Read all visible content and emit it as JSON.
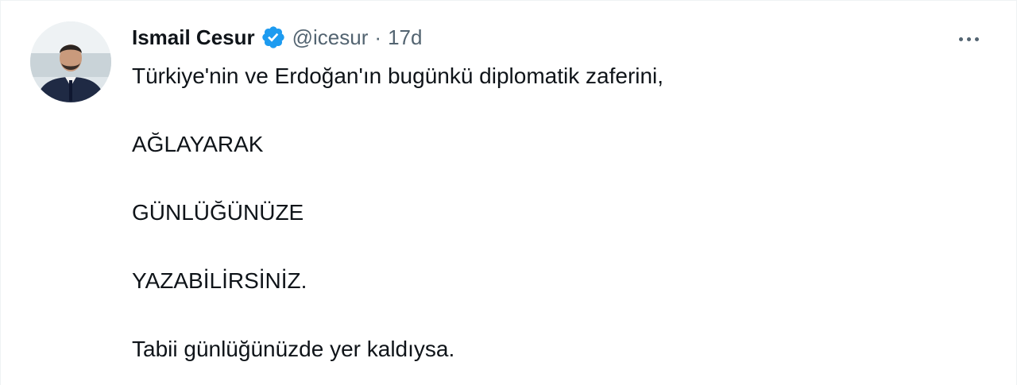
{
  "tweet": {
    "author": {
      "display_name": "Ismail Cesur",
      "handle": "@icesur",
      "verified": true,
      "avatar_icon": "person-photo"
    },
    "separator": "·",
    "time": "17d",
    "more_icon": "more-horizontal-icon",
    "lines": [
      "Türkiye'nin ve Erdoğan'ın bugünkü diplomatik zaferini,",
      "AĞLAYARAK",
      "GÜNLÜĞÜNÜZE",
      "YAZABİLİRSİNİZ.",
      "Tabii günlüğünüzde yer kaldıysa."
    ]
  },
  "colors": {
    "text_primary": "#0f1419",
    "text_secondary": "#536471",
    "verified_blue": "#1d9bf0",
    "border": "#eff3f4"
  }
}
